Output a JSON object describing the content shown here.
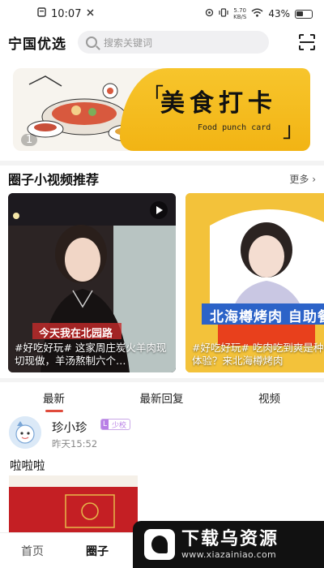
{
  "status": {
    "time": "10:07",
    "network_speed": "5.70",
    "network_unit": "KB/S",
    "battery": "43%"
  },
  "header": {
    "app_title": "宁国优选",
    "search_placeholder": "搜索关键词",
    "scan_icon": "scan-icon"
  },
  "banner": {
    "title": "美食打卡",
    "subtitle": "Food punch card",
    "index": "1",
    "accent": "#f4bd1f"
  },
  "section": {
    "title": "圈子小视频推荐",
    "more": "更多"
  },
  "videos": [
    {
      "overlay": "今天我在北园路",
      "caption": "#好吃好玩# 这家周庄炭火羊肉现切现做，羊汤熬制六个…"
    },
    {
      "overlay": "北海樽烤肉 自助餐",
      "caption": "#好吃好玩# 吃肉吃到爽是种什么体验？来北海樽烤肉"
    }
  ],
  "tabs": [
    {
      "label": "最新",
      "active": true
    },
    {
      "label": "最新回复",
      "active": false
    },
    {
      "label": "视频",
      "active": false
    }
  ],
  "post": {
    "user": "珍小珍",
    "level_tag": "L",
    "level_name": "少校",
    "time": "昨天15:52",
    "text": "啦啦啦"
  },
  "bottom_nav": [
    {
      "label": "首页",
      "active": false
    },
    {
      "label": "圈子",
      "active": true
    }
  ],
  "watermark": {
    "title": "下载乌资源",
    "url": "www.xiazainiao.com"
  },
  "colors": {
    "accent_red": "#e04b3c",
    "level_purple": "#b87ee6"
  }
}
